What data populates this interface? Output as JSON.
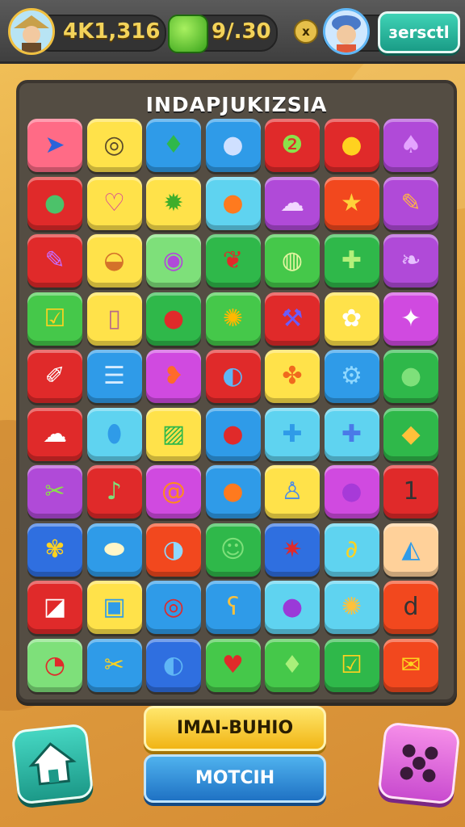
{
  "hud": {
    "coins": "4K1,316",
    "moves": "9/.30",
    "close_label": "x",
    "top_button_label": "зersctl"
  },
  "board": {
    "title": "INDAPJUKIZSIA",
    "rows": [
      [
        {
          "color": "#ff6b86",
          "icon": "cursor-icon",
          "glyph": "➤",
          "fg": "#2b63d9"
        },
        {
          "color": "#ffe24a",
          "icon": "spiral-icon",
          "glyph": "◎",
          "fg": "#5a4a2a"
        },
        {
          "color": "#2f9be8",
          "icon": "leaf-icon",
          "glyph": "♦",
          "fg": "#2fb84a"
        },
        {
          "color": "#2f9be8",
          "icon": "moon-icon",
          "glyph": "●",
          "fg": "#cfe0ff"
        },
        {
          "color": "#e02a2a",
          "icon": "leaf-badge-icon",
          "glyph": "❷",
          "fg": "#8be04a"
        },
        {
          "color": "#e02a2a",
          "icon": "lemon-icon",
          "glyph": "●",
          "fg": "#ffd21f"
        },
        {
          "color": "#b04ad8",
          "icon": "bulb-icon",
          "glyph": "♠",
          "fg": "#e4a4ff"
        }
      ],
      [
        {
          "color": "#e02a2a",
          "icon": "ball-icon",
          "glyph": "●",
          "fg": "#4cc26a"
        },
        {
          "color": "#ffe24a",
          "icon": "heart-bubble-icon",
          "glyph": "♡",
          "fg": "#d4389e"
        },
        {
          "color": "#ffe24a",
          "icon": "sunflower-icon",
          "glyph": "✹",
          "fg": "#3fae2a"
        },
        {
          "color": "#5fd3f0",
          "icon": "orange-icon",
          "glyph": "●",
          "fg": "#ff7a1e"
        },
        {
          "color": "#b04ad8",
          "icon": "cloud-icon",
          "glyph": "☁",
          "fg": "#f2d6ff"
        },
        {
          "color": "#f2481e",
          "icon": "star-icon",
          "glyph": "★",
          "fg": "#ffd23a"
        },
        {
          "color": "#b04ad8",
          "icon": "pencil-icon",
          "glyph": "✎",
          "fg": "#ffb347"
        }
      ],
      [
        {
          "color": "#e02a2a",
          "icon": "pencil-purple-icon",
          "glyph": "✎",
          "fg": "#c86cff"
        },
        {
          "color": "#ffe24a",
          "icon": "bowl-icon",
          "glyph": "◒",
          "fg": "#d4722a"
        },
        {
          "color": "#7ee07a",
          "icon": "target-icon",
          "glyph": "◉",
          "fg": "#b04ad8"
        },
        {
          "color": "#2fb84a",
          "icon": "pepper-icon",
          "glyph": "❦",
          "fg": "#e02a2a"
        },
        {
          "color": "#45c84a",
          "icon": "swirl-icon",
          "glyph": "◍",
          "fg": "#e2f5a0"
        },
        {
          "color": "#2fb84a",
          "icon": "puzzle-icon",
          "glyph": "✚",
          "fg": "#b4f07a"
        },
        {
          "color": "#b04ad8",
          "icon": "wing-icon",
          "glyph": "❧",
          "fg": "#e6c0ff"
        }
      ],
      [
        {
          "color": "#45c84a",
          "icon": "checkbox-icon",
          "glyph": "☑",
          "fg": "#ffd21f"
        },
        {
          "color": "#ffe24a",
          "icon": "phone-icon",
          "glyph": "▯",
          "fg": "#b86b8a"
        },
        {
          "color": "#2fb84a",
          "icon": "apple-icon",
          "glyph": "●",
          "fg": "#e02a2a"
        },
        {
          "color": "#45c84a",
          "icon": "sun-icon",
          "glyph": "✺",
          "fg": "#ffb800"
        },
        {
          "color": "#e02a2a",
          "icon": "hammer-icon",
          "glyph": "⚒",
          "fg": "#6a5cff"
        },
        {
          "color": "#ffe24a",
          "icon": "daisy-icon",
          "glyph": "✿",
          "fg": "#ffffff"
        },
        {
          "color": "#d04ae0",
          "icon": "star-bubble-icon",
          "glyph": "✦",
          "fg": "#ffffff"
        }
      ],
      [
        {
          "color": "#e02a2a",
          "icon": "note-pen-icon",
          "glyph": "✐",
          "fg": "#ffffff"
        },
        {
          "color": "#2f9be8",
          "icon": "list-icon",
          "glyph": "☰",
          "fg": "#d6ecff"
        },
        {
          "color": "#d04ae0",
          "icon": "heart-icon",
          "glyph": "❥",
          "fg": "#ff6a2a"
        },
        {
          "color": "#e02a2a",
          "icon": "globe-icon",
          "glyph": "◐",
          "fg": "#5fb6f5"
        },
        {
          "color": "#ffe24a",
          "icon": "bow-icon",
          "glyph": "✤",
          "fg": "#f06a1e"
        },
        {
          "color": "#2f9be8",
          "icon": "gears-icon",
          "glyph": "⚙",
          "fg": "#8fd8ff"
        },
        {
          "color": "#2fb84a",
          "icon": "lime-icon",
          "glyph": "●",
          "fg": "#7ee07a"
        }
      ],
      [
        {
          "color": "#e02a2a",
          "icon": "cloud-badge-icon",
          "glyph": "☁",
          "fg": "#ffffff"
        },
        {
          "color": "#5fd3f0",
          "icon": "capsule-icon",
          "glyph": "⬮",
          "fg": "#2f9be8"
        },
        {
          "color": "#ffe24a",
          "icon": "ruler-icon",
          "glyph": "▨",
          "fg": "#2fb84a"
        },
        {
          "color": "#2f9be8",
          "icon": "tomato-icon",
          "glyph": "●",
          "fg": "#e02a2a"
        },
        {
          "color": "#5fd3f0",
          "icon": "clover-icon",
          "glyph": "✚",
          "fg": "#2f9be8"
        },
        {
          "color": "#5fd3f0",
          "icon": "plus-flower-icon",
          "glyph": "✚",
          "fg": "#4a7ae8"
        },
        {
          "color": "#2fb84a",
          "icon": "carrot-icon",
          "glyph": "◆",
          "fg": "#ffc13a"
        }
      ],
      [
        {
          "color": "#b04ad8",
          "icon": "candy-icon",
          "glyph": "✂",
          "fg": "#8be04a"
        },
        {
          "color": "#e02a2a",
          "icon": "maraca-icon",
          "glyph": "♪",
          "fg": "#7ee07a"
        },
        {
          "color": "#d04ae0",
          "icon": "snail-icon",
          "glyph": "@",
          "fg": "#ff8a1e"
        },
        {
          "color": "#2f9be8",
          "icon": "peach-icon",
          "glyph": "●",
          "fg": "#ff7a1e"
        },
        {
          "color": "#ffe24a",
          "icon": "lightbulb-icon",
          "glyph": "♙",
          "fg": "#4a8ae8"
        },
        {
          "color": "#d04ae0",
          "icon": "plum-icon",
          "glyph": "●",
          "fg": "#a73ad8"
        },
        {
          "color": "#e02a2a",
          "icon": "number-one-icon",
          "glyph": "1",
          "fg": "#333333"
        }
      ],
      [
        {
          "color": "#2f6fe0",
          "icon": "flower-icon",
          "glyph": "✾",
          "fg": "#ffd21f"
        },
        {
          "color": "#2f9be8",
          "icon": "seed-icon",
          "glyph": "⬬",
          "fg": "#fff6c8"
        },
        {
          "color": "#f2481e",
          "icon": "beach-ball-icon",
          "glyph": "◑",
          "fg": "#8fd8ff"
        },
        {
          "color": "#2fb84a",
          "icon": "face-icon",
          "glyph": "☺",
          "fg": "#7ee07a"
        },
        {
          "color": "#2f6fe0",
          "icon": "compass-icon",
          "glyph": "✷",
          "fg": "#e02a2a"
        },
        {
          "color": "#5fd3f0",
          "icon": "swirl-yellow-icon",
          "glyph": "∂",
          "fg": "#ffd21f"
        },
        {
          "color": "#ffd19a",
          "icon": "kite-icon",
          "glyph": "◭",
          "fg": "#2f9be8"
        }
      ],
      [
        {
          "color": "#e02a2a",
          "icon": "envelope-icon",
          "glyph": "◪",
          "fg": "#ffffff"
        },
        {
          "color": "#ffe24a",
          "icon": "tv-icon",
          "glyph": "▣",
          "fg": "#2f9be8"
        },
        {
          "color": "#2f9be8",
          "icon": "rose-icon",
          "glyph": "◎",
          "fg": "#e02a2a"
        },
        {
          "color": "#2f9be8",
          "icon": "duck-icon",
          "glyph": "ʕ",
          "fg": "#ffc13a"
        },
        {
          "color": "#5fd3f0",
          "icon": "orb-icon",
          "glyph": "●",
          "fg": "#9a3ad8"
        },
        {
          "color": "#5fd3f0",
          "icon": "sunburst-icon",
          "glyph": "✺",
          "fg": "#ffc13a"
        },
        {
          "color": "#f2481e",
          "icon": "letter-d-icon",
          "glyph": "d",
          "fg": "#333333"
        }
      ],
      [
        {
          "color": "#7ee07a",
          "icon": "clock-icon",
          "glyph": "◔",
          "fg": "#e02a2a"
        },
        {
          "color": "#2f9be8",
          "icon": "scissors-icon",
          "glyph": "✂",
          "fg": "#ffd21f"
        },
        {
          "color": "#2f6fe0",
          "icon": "feather-icon",
          "glyph": "◐",
          "fg": "#5fb6f5"
        },
        {
          "color": "#45c84a",
          "icon": "strawberry-icon",
          "glyph": "♥",
          "fg": "#e02a2a"
        },
        {
          "color": "#45c84a",
          "icon": "leaf-green-icon",
          "glyph": "♦",
          "fg": "#a8f07a"
        },
        {
          "color": "#2fb84a",
          "icon": "check-note-icon",
          "glyph": "☑",
          "fg": "#ffd21f"
        },
        {
          "color": "#f2481e",
          "icon": "paper-icon",
          "glyph": "✉",
          "fg": "#ffd21f"
        }
      ]
    ]
  },
  "buttons": {
    "primary_label": "IMΔI-BUHIO",
    "secondary_label": "MOTCIH"
  }
}
